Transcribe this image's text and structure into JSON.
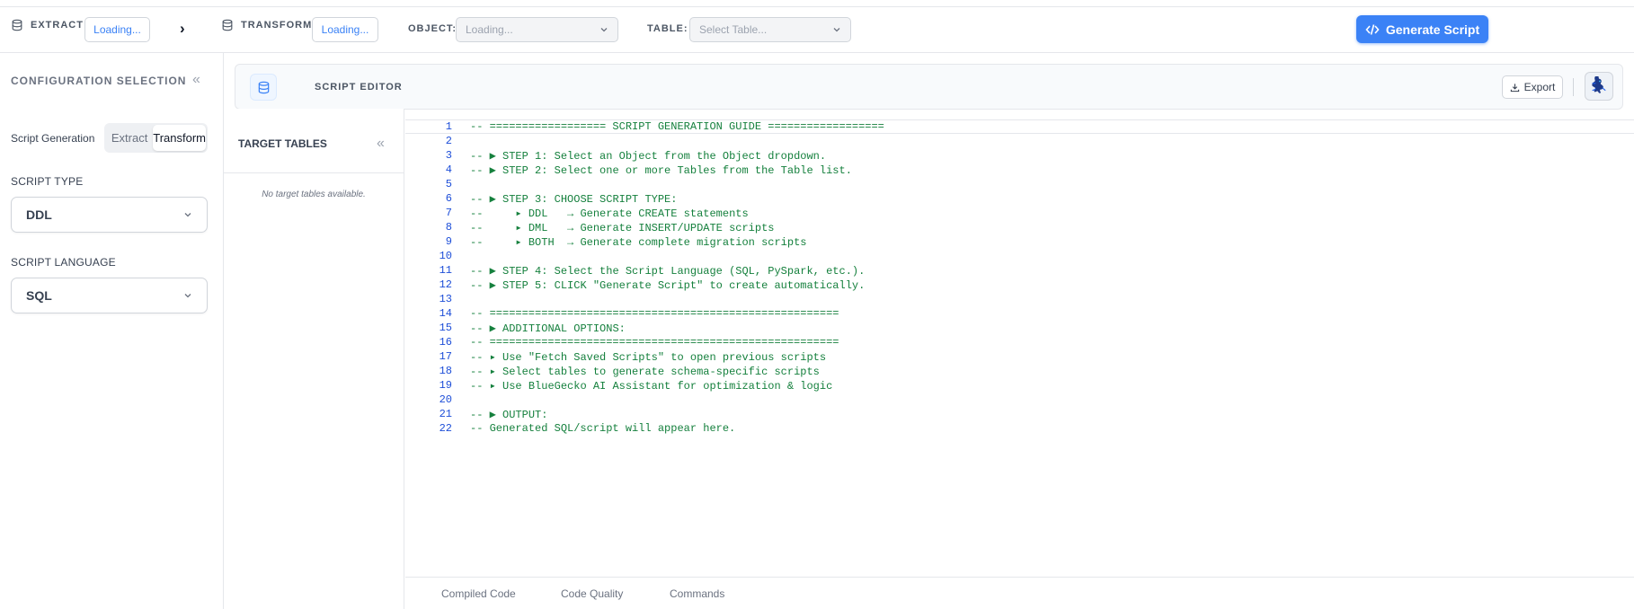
{
  "toolbar": {
    "extract_label": "EXTRACT",
    "extract_value": "Loading...",
    "transform_label": "TRANSFORM",
    "transform_value": "Loading...",
    "object_label": "OBJECT:",
    "object_placeholder": "Loading...",
    "table_label": "TABLE:",
    "table_placeholder": "Select Table...",
    "generate_button": "Generate Script",
    "arrow": "›"
  },
  "config": {
    "title": "CONFIGURATION SELECTION",
    "collapse": "«",
    "script_generation_label": "Script Generation",
    "toggle_options": [
      "Extract",
      "Transform"
    ],
    "active_toggle": "Transform",
    "script_type_label": "SCRIPT TYPE",
    "script_type_value": "DDL",
    "script_language_label": "SCRIPT LANGUAGE",
    "script_language_value": "SQL"
  },
  "targets": {
    "title": "TARGET TABLES",
    "collapse": "«",
    "empty_message": "No target tables available."
  },
  "editor": {
    "title": "SCRIPT EDITOR",
    "export_label": "Export",
    "lines": [
      "-- ================== SCRIPT GENERATION GUIDE ==================",
      "",
      "-- ▶ STEP 1: Select an Object from the Object dropdown.",
      "-- ▶ STEP 2: Select one or more Tables from the Table list.",
      "",
      "-- ▶ STEP 3: CHOOSE SCRIPT TYPE:",
      "--     ▸ DDL   → Generate CREATE statements",
      "--     ▸ DML   → Generate INSERT/UPDATE scripts",
      "--     ▸ BOTH  → Generate complete migration scripts",
      "",
      "-- ▶ STEP 4: Select the Script Language (SQL, PySpark, etc.).",
      "-- ▶ STEP 5: CLICK \"Generate Script\" to create automatically.",
      "",
      "-- ======================================================",
      "-- ▶ ADDITIONAL OPTIONS:",
      "-- ======================================================",
      "-- ▸ Use \"Fetch Saved Scripts\" to open previous scripts",
      "-- ▸ Select tables to generate schema-specific scripts",
      "-- ▸ Use BlueGecko AI Assistant for optimization & logic",
      "",
      "-- ▶ OUTPUT:",
      "-- Generated SQL/script will appear here."
    ]
  },
  "bottom_tabs": [
    "Compiled Code",
    "Code Quality",
    "Commands"
  ],
  "colors": {
    "accent": "#3b82f6",
    "code_text": "#15803d",
    "line_number": "#1d4ed8"
  }
}
